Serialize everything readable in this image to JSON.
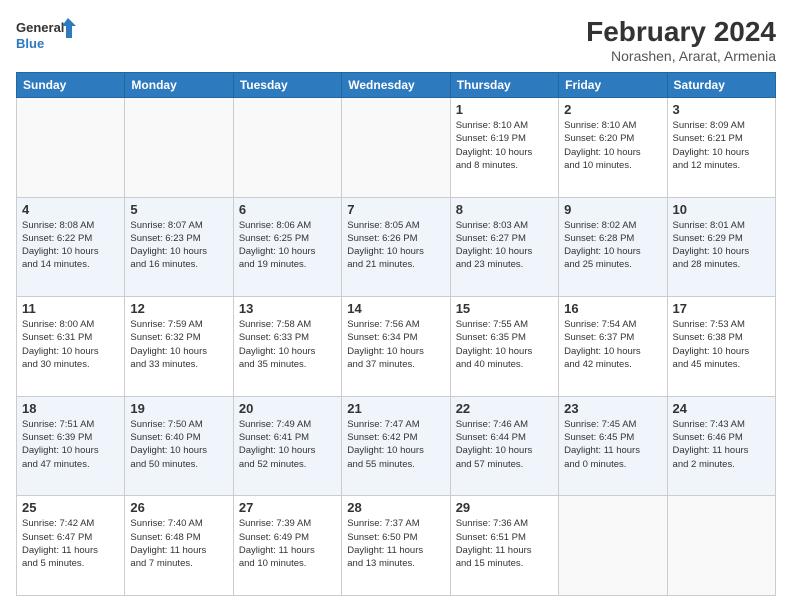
{
  "header": {
    "logo_general": "General",
    "logo_blue": "Blue",
    "title": "February 2024",
    "subtitle": "Norashen, Ararat, Armenia"
  },
  "days_of_week": [
    "Sunday",
    "Monday",
    "Tuesday",
    "Wednesday",
    "Thursday",
    "Friday",
    "Saturday"
  ],
  "weeks": [
    {
      "stripe": false,
      "days": [
        {
          "num": "",
          "info": ""
        },
        {
          "num": "",
          "info": ""
        },
        {
          "num": "",
          "info": ""
        },
        {
          "num": "",
          "info": ""
        },
        {
          "num": "1",
          "info": "Sunrise: 8:10 AM\nSunset: 6:19 PM\nDaylight: 10 hours\nand 8 minutes."
        },
        {
          "num": "2",
          "info": "Sunrise: 8:10 AM\nSunset: 6:20 PM\nDaylight: 10 hours\nand 10 minutes."
        },
        {
          "num": "3",
          "info": "Sunrise: 8:09 AM\nSunset: 6:21 PM\nDaylight: 10 hours\nand 12 minutes."
        }
      ]
    },
    {
      "stripe": true,
      "days": [
        {
          "num": "4",
          "info": "Sunrise: 8:08 AM\nSunset: 6:22 PM\nDaylight: 10 hours\nand 14 minutes."
        },
        {
          "num": "5",
          "info": "Sunrise: 8:07 AM\nSunset: 6:23 PM\nDaylight: 10 hours\nand 16 minutes."
        },
        {
          "num": "6",
          "info": "Sunrise: 8:06 AM\nSunset: 6:25 PM\nDaylight: 10 hours\nand 19 minutes."
        },
        {
          "num": "7",
          "info": "Sunrise: 8:05 AM\nSunset: 6:26 PM\nDaylight: 10 hours\nand 21 minutes."
        },
        {
          "num": "8",
          "info": "Sunrise: 8:03 AM\nSunset: 6:27 PM\nDaylight: 10 hours\nand 23 minutes."
        },
        {
          "num": "9",
          "info": "Sunrise: 8:02 AM\nSunset: 6:28 PM\nDaylight: 10 hours\nand 25 minutes."
        },
        {
          "num": "10",
          "info": "Sunrise: 8:01 AM\nSunset: 6:29 PM\nDaylight: 10 hours\nand 28 minutes."
        }
      ]
    },
    {
      "stripe": false,
      "days": [
        {
          "num": "11",
          "info": "Sunrise: 8:00 AM\nSunset: 6:31 PM\nDaylight: 10 hours\nand 30 minutes."
        },
        {
          "num": "12",
          "info": "Sunrise: 7:59 AM\nSunset: 6:32 PM\nDaylight: 10 hours\nand 33 minutes."
        },
        {
          "num": "13",
          "info": "Sunrise: 7:58 AM\nSunset: 6:33 PM\nDaylight: 10 hours\nand 35 minutes."
        },
        {
          "num": "14",
          "info": "Sunrise: 7:56 AM\nSunset: 6:34 PM\nDaylight: 10 hours\nand 37 minutes."
        },
        {
          "num": "15",
          "info": "Sunrise: 7:55 AM\nSunset: 6:35 PM\nDaylight: 10 hours\nand 40 minutes."
        },
        {
          "num": "16",
          "info": "Sunrise: 7:54 AM\nSunset: 6:37 PM\nDaylight: 10 hours\nand 42 minutes."
        },
        {
          "num": "17",
          "info": "Sunrise: 7:53 AM\nSunset: 6:38 PM\nDaylight: 10 hours\nand 45 minutes."
        }
      ]
    },
    {
      "stripe": true,
      "days": [
        {
          "num": "18",
          "info": "Sunrise: 7:51 AM\nSunset: 6:39 PM\nDaylight: 10 hours\nand 47 minutes."
        },
        {
          "num": "19",
          "info": "Sunrise: 7:50 AM\nSunset: 6:40 PM\nDaylight: 10 hours\nand 50 minutes."
        },
        {
          "num": "20",
          "info": "Sunrise: 7:49 AM\nSunset: 6:41 PM\nDaylight: 10 hours\nand 52 minutes."
        },
        {
          "num": "21",
          "info": "Sunrise: 7:47 AM\nSunset: 6:42 PM\nDaylight: 10 hours\nand 55 minutes."
        },
        {
          "num": "22",
          "info": "Sunrise: 7:46 AM\nSunset: 6:44 PM\nDaylight: 10 hours\nand 57 minutes."
        },
        {
          "num": "23",
          "info": "Sunrise: 7:45 AM\nSunset: 6:45 PM\nDaylight: 11 hours\nand 0 minutes."
        },
        {
          "num": "24",
          "info": "Sunrise: 7:43 AM\nSunset: 6:46 PM\nDaylight: 11 hours\nand 2 minutes."
        }
      ]
    },
    {
      "stripe": false,
      "days": [
        {
          "num": "25",
          "info": "Sunrise: 7:42 AM\nSunset: 6:47 PM\nDaylight: 11 hours\nand 5 minutes."
        },
        {
          "num": "26",
          "info": "Sunrise: 7:40 AM\nSunset: 6:48 PM\nDaylight: 11 hours\nand 7 minutes."
        },
        {
          "num": "27",
          "info": "Sunrise: 7:39 AM\nSunset: 6:49 PM\nDaylight: 11 hours\nand 10 minutes."
        },
        {
          "num": "28",
          "info": "Sunrise: 7:37 AM\nSunset: 6:50 PM\nDaylight: 11 hours\nand 13 minutes."
        },
        {
          "num": "29",
          "info": "Sunrise: 7:36 AM\nSunset: 6:51 PM\nDaylight: 11 hours\nand 15 minutes."
        },
        {
          "num": "",
          "info": ""
        },
        {
          "num": "",
          "info": ""
        }
      ]
    }
  ]
}
